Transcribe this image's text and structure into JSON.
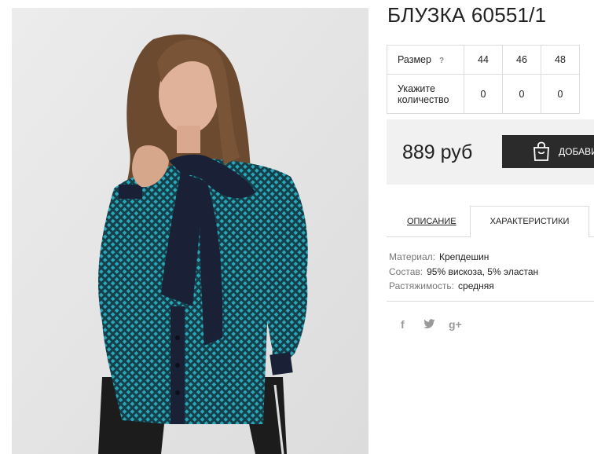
{
  "product": {
    "title": "БЛУЗКА 60551/1",
    "image_alt": "Блузка 60551/1"
  },
  "sizes": {
    "size_label": "Размер",
    "help_mark": "?",
    "quantity_label": "Укажите количество",
    "columns": [
      "44",
      "46",
      "48"
    ],
    "quantities": [
      "0",
      "0",
      "0"
    ]
  },
  "purchase": {
    "price": "889 руб",
    "add_button": "ДОБАВИ"
  },
  "tabs": {
    "description": "ОПИСАНИЕ",
    "specs": "ХАРАКТЕРИСТИКИ"
  },
  "specs": [
    {
      "key": "Материал:",
      "value": "Крепдешин"
    },
    {
      "key": "Состав:",
      "value": "95% вискоза, 5% эластан"
    },
    {
      "key": "Растяжимость:",
      "value": "средняя"
    }
  ],
  "social": {
    "facebook": "f",
    "twitter": "🐦",
    "googleplus": "g+"
  },
  "colors": {
    "blouse": "#1c6e7e",
    "bow": "#1a2036",
    "button_bg": "#2b2b2b",
    "price_bg": "#f1f1f1"
  }
}
